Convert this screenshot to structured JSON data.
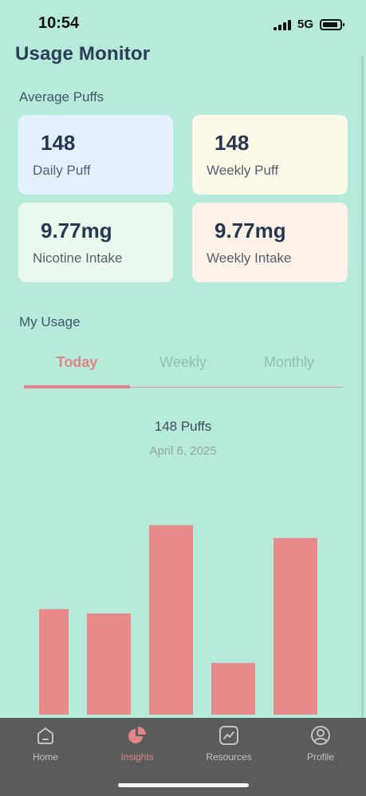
{
  "status_bar": {
    "time": "10:54",
    "network": "5G"
  },
  "page": {
    "title": "Usage Monitor"
  },
  "average_puffs": {
    "label": "Average Puffs",
    "cards": [
      {
        "value": "148",
        "label": "Daily Puff",
        "color": "#e5f0ff"
      },
      {
        "value": "148",
        "label": "Weekly Puff",
        "color": "#fdf9e8"
      },
      {
        "value": "9.77mg",
        "label": "Nicotine Intake",
        "color": "#eaf8ee"
      },
      {
        "value": "9.77mg",
        "label": "Weekly Intake",
        "color": "#fdf1e8"
      }
    ]
  },
  "my_usage": {
    "label": "My Usage",
    "tabs": [
      {
        "label": "Today",
        "active": true
      },
      {
        "label": "Weekly",
        "active": false
      },
      {
        "label": "Monthly",
        "active": false
      }
    ],
    "summary": "148 Puffs",
    "date": "April 6, 2025"
  },
  "chart_data": {
    "type": "bar",
    "values": [
      49,
      47,
      88,
      24,
      82
    ],
    "ylim": [
      0,
      100
    ],
    "bar_color": "#e88a89"
  },
  "tab_bar": {
    "items": [
      {
        "label": "Home",
        "icon": "home-icon",
        "active": false
      },
      {
        "label": "Insights",
        "icon": "pie-chart-icon",
        "active": true
      },
      {
        "label": "Resources",
        "icon": "trend-chart-icon",
        "active": false
      },
      {
        "label": "Profile",
        "icon": "user-icon",
        "active": false
      }
    ]
  },
  "colors": {
    "background": "#b6eadb",
    "accent": "#e38587",
    "title": "#2b3d55",
    "tab_bar": "#5a5b5b"
  }
}
